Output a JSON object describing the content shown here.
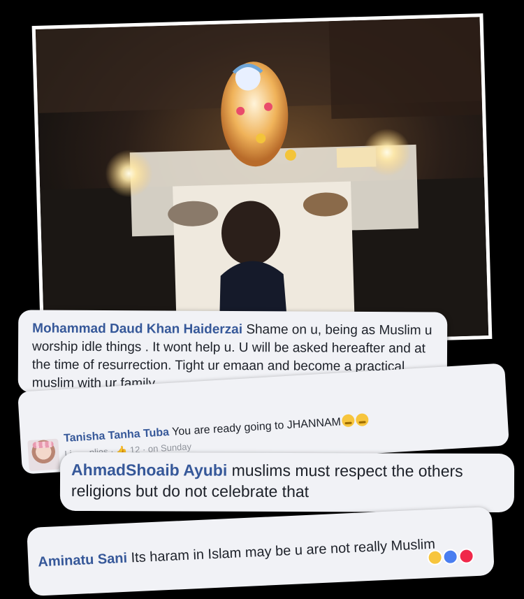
{
  "comments": [
    {
      "author": "Mohammad Daud Khan Haiderzai",
      "text": "Shame on u, being as Muslim u worship idle things . It wont help u. U will be asked hereafter and at the time of resurrection. Tight ur emaan and become a practical muslim with ur family ."
    },
    {
      "author": "Tanisha Tanha Tuba",
      "text": "You are ready going to JHANNAM",
      "meta_partial": "Li",
      "meta_replies": "plies",
      "likes": "12",
      "time": "on Sunday"
    },
    {
      "author": "AhmadShoaib Ayubi",
      "text": "muslims must respect the others religions but do not celebrate that"
    },
    {
      "author": "Aminatu Sani",
      "text": "Its haram in Islam may be u are not really Muslim"
    }
  ],
  "colors": {
    "author": "#365899",
    "bubble": "#f1f2f6",
    "background": "#000000"
  }
}
